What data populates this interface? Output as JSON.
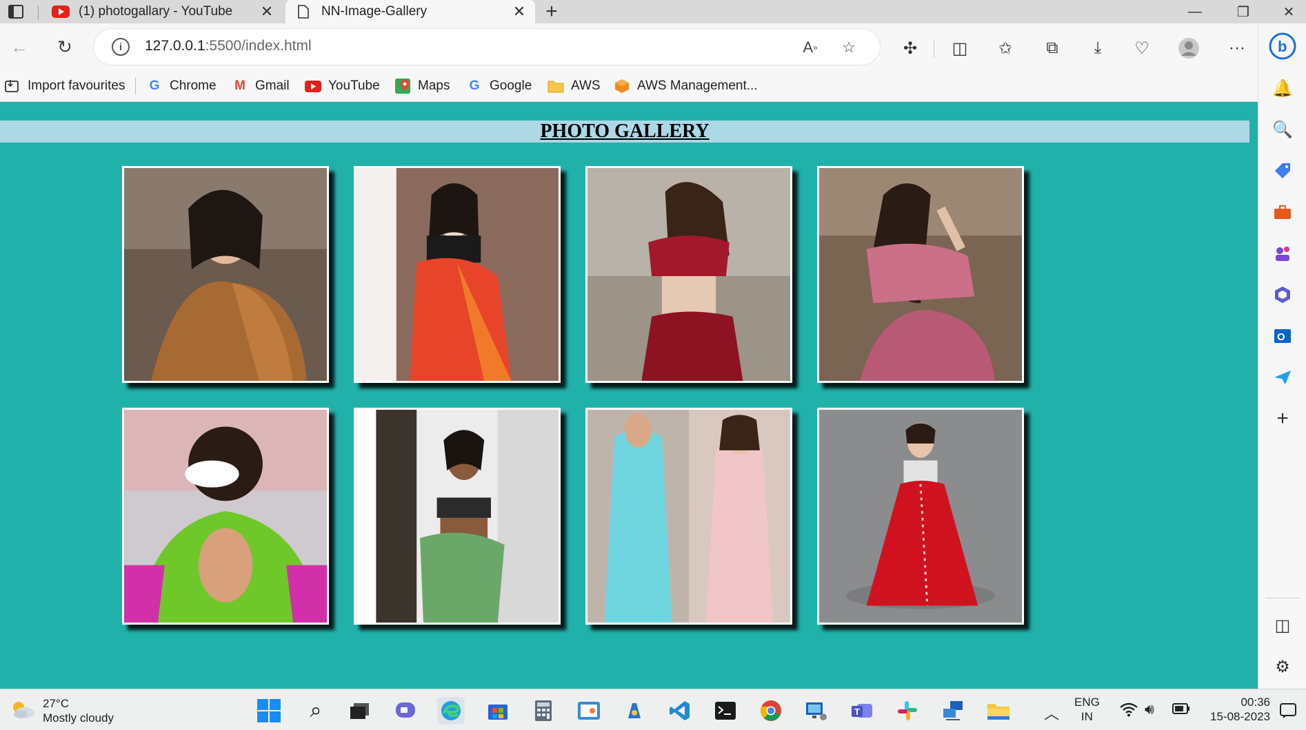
{
  "browser": {
    "tabs": [
      {
        "label": "(1) photogallary - YouTube",
        "icon": "youtube-icon",
        "active": false
      },
      {
        "label": "NN-Image-Gallery",
        "icon": "page-icon",
        "active": true
      }
    ],
    "url_host": "127.0.0.1",
    "url_path": ":5500/index.html",
    "favourites": [
      {
        "label": "Import favourites",
        "icon": "import-icon"
      },
      {
        "label": "Chrome",
        "icon": "google-icon"
      },
      {
        "label": "Gmail",
        "icon": "gmail-icon"
      },
      {
        "label": "YouTube",
        "icon": "youtube-icon"
      },
      {
        "label": "Maps",
        "icon": "maps-icon"
      },
      {
        "label": "Google",
        "icon": "google-icon"
      },
      {
        "label": "AWS",
        "icon": "folder-icon"
      },
      {
        "label": "AWS Management...",
        "icon": "aws-icon"
      }
    ]
  },
  "page": {
    "heading": "PHOTO GALLERY",
    "background": "#20b2aa",
    "heading_band": "#add8e6",
    "photos": [
      {
        "name": "photo-1",
        "palette": [
          "#6b5a4e",
          "#a86a33",
          "#cfa57c"
        ]
      },
      {
        "name": "photo-2",
        "palette": [
          "#8a6a5c",
          "#e8442a",
          "#f3d9c7"
        ]
      },
      {
        "name": "photo-3",
        "palette": [
          "#b9b2a8",
          "#a3182a",
          "#e6c9b3"
        ]
      },
      {
        "name": "photo-4",
        "palette": [
          "#7a6552",
          "#cc6f88",
          "#e0c0a8"
        ]
      },
      {
        "name": "photo-5",
        "palette": [
          "#cfcad0",
          "#6fc82a",
          "#d130a8"
        ]
      },
      {
        "name": "photo-6",
        "palette": [
          "#ececec",
          "#6aa86a",
          "#2b2b2b"
        ]
      },
      {
        "name": "photo-7",
        "palette": [
          "#6fd6e0",
          "#f0c6c8",
          "#bfb4ac"
        ]
      },
      {
        "name": "photo-8",
        "palette": [
          "#8a8c8e",
          "#d0121f",
          "#e3e3e3"
        ]
      }
    ]
  },
  "taskbar": {
    "weather_temp": "27°C",
    "weather_desc": "Mostly cloudy",
    "lang_1": "ENG",
    "lang_2": "IN",
    "time": "00:36",
    "date": "15-08-2023"
  }
}
